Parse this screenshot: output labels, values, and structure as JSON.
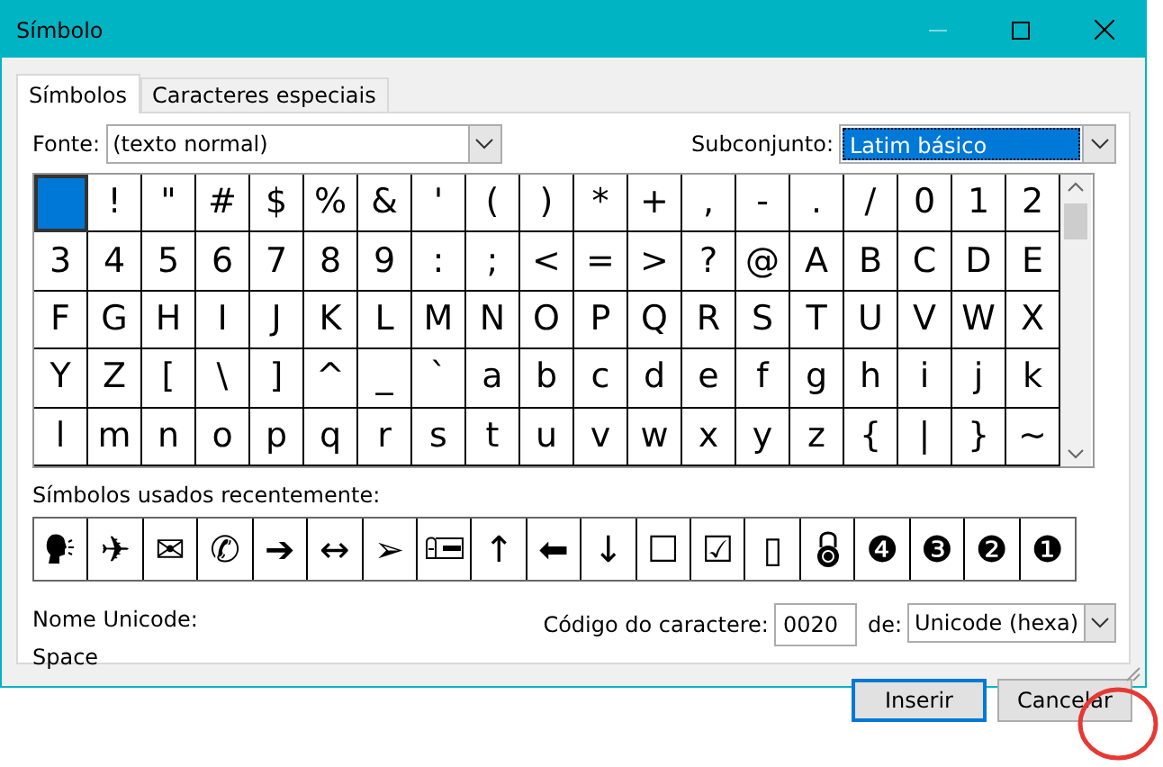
{
  "window": {
    "title": "Símbolo"
  },
  "tabs": [
    {
      "label": "Símbolos",
      "selected": true
    },
    {
      "label": "Caracteres especiais",
      "selected": false
    }
  ],
  "font": {
    "label": "Fonte:",
    "value": "(texto normal)"
  },
  "subset": {
    "label": "Subconjunto:",
    "value": "Latim básico"
  },
  "selected_symbol": {
    "selected": true
  },
  "symbols": [
    "!",
    "\"",
    "#",
    "$",
    "%",
    "&",
    "'",
    "(",
    ")",
    "*",
    "+",
    ",",
    "-",
    ".",
    "/",
    "0",
    "1",
    "2",
    "3",
    "4",
    "5",
    "6",
    "7",
    "8",
    "9",
    ":",
    ";",
    "<",
    "=",
    ">",
    "?",
    "@",
    "A",
    "B",
    "C",
    "D",
    "E",
    "F",
    "G",
    "H",
    "I",
    "J",
    "K",
    "L",
    "M",
    "N",
    "O",
    "P",
    "Q",
    "R",
    "S",
    "T",
    "U",
    "V",
    "W",
    "X",
    "Y",
    "Z",
    "[",
    "\\",
    "]",
    "^",
    "_",
    "`",
    "a",
    "b",
    "c",
    "d",
    "e",
    "f",
    "g",
    "h",
    "i",
    "j",
    "k",
    "l",
    "m",
    "n",
    "o",
    "p",
    "q",
    "r",
    "s",
    "t",
    "u",
    "v",
    "w",
    "x",
    "y",
    "z",
    "{",
    "|",
    "}",
    "~"
  ],
  "recent": {
    "label": "Símbolos usados recentemente:",
    "items": [
      {
        "kind": "head"
      },
      {
        "kind": "char",
        "char": "✈"
      },
      {
        "kind": "char",
        "char": "✉"
      },
      {
        "kind": "char",
        "char": "✆"
      },
      {
        "kind": "char",
        "char": "➔"
      },
      {
        "kind": "char",
        "char": "↔"
      },
      {
        "kind": "char",
        "char": "➢"
      },
      {
        "kind": "mailbox"
      },
      {
        "kind": "char",
        "char": "↑"
      },
      {
        "kind": "char",
        "char": "⬅"
      },
      {
        "kind": "char",
        "char": "↓"
      },
      {
        "kind": "char",
        "char": "☐"
      },
      {
        "kind": "char",
        "char": "☑"
      },
      {
        "kind": "char",
        "char": "▯"
      },
      {
        "kind": "lock"
      },
      {
        "kind": "char",
        "char": "❹"
      },
      {
        "kind": "char",
        "char": "❸"
      },
      {
        "kind": "char",
        "char": "❷"
      },
      {
        "kind": "char",
        "char": "❶"
      }
    ]
  },
  "unicode_name": {
    "label": "Nome Unicode:",
    "value": "Space"
  },
  "char_code": {
    "label": "Código do caractere:",
    "value": "0020"
  },
  "from": {
    "label": "de:",
    "value": "Unicode (hexa)"
  },
  "buttons": [
    {
      "label": "Inserir",
      "default": true
    },
    {
      "label": "Cancelar",
      "default": false
    }
  ]
}
